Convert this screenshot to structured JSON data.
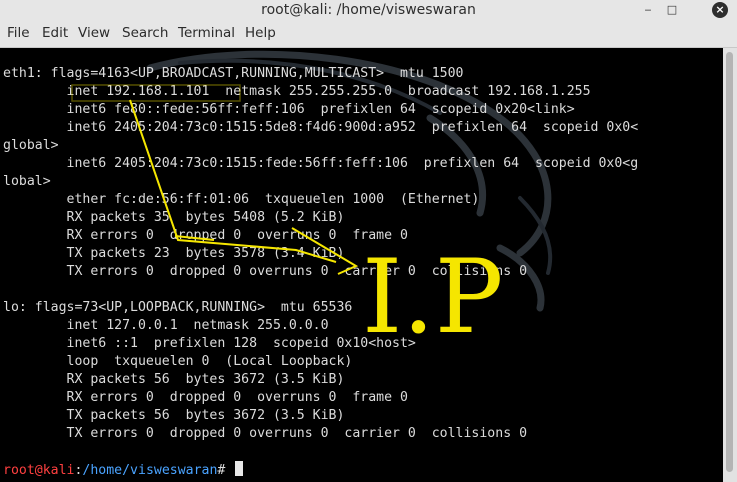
{
  "window": {
    "title": "root@kali: /home/visweswaran",
    "minimize_glyph": "‒",
    "maximize_glyph": "□",
    "close_glyph": "×"
  },
  "menu": {
    "file": "File",
    "edit": "Edit",
    "view": "View",
    "search": "Search",
    "terminal": "Terminal",
    "help": "Help"
  },
  "terminal": {
    "lines": [
      "eth1: flags=4163<UP,BROADCAST,RUNNING,MULTICAST>  mtu 1500",
      "        inet 192.168.1.101  netmask 255.255.255.0  broadcast 192.168.1.255",
      "        inet6 fe80::fede:56ff:feff:106  prefixlen 64  scopeid 0x20<link>",
      "        inet6 2405:204:73c0:1515:5de8:f4d6:900d:a952  prefixlen 64  scopeid 0x0<",
      "global>",
      "        inet6 2405:204:73c0:1515:fede:56ff:feff:106  prefixlen 64  scopeid 0x0<g",
      "lobal>",
      "        ether fc:de:56:ff:01:06  txqueuelen 1000  (Ethernet)",
      "        RX packets 35  bytes 5408 (5.2 KiB)",
      "        RX errors 0  dropped 0  overruns 0  frame 0",
      "        TX packets 23  bytes 3578 (3.4 KiB)",
      "        TX errors 0  dropped 0 overruns 0  carrier 0  collisions 0",
      "",
      "lo: flags=73<UP,LOOPBACK,RUNNING>  mtu 65536",
      "        inet 127.0.0.1  netmask 255.0.0.0",
      "        inet6 ::1  prefixlen 128  scopeid 0x10<host>",
      "        loop  txqueuelen 0  (Local Loopback)",
      "        RX packets 56  bytes 3672 (3.5 KiB)",
      "        RX errors 0  dropped 0  overruns 0  frame 0",
      "        TX packets 56  bytes 3672 (3.5 KiB)",
      "        TX errors 0  dropped 0 overruns 0  carrier 0  collisions 0"
    ],
    "prompt": {
      "user_host": "root@kali",
      "colon": ":",
      "path": "/home/visweswaran",
      "symbol": "#"
    }
  },
  "annotation": {
    "label": "I.P",
    "color": "#f5e600"
  },
  "colors": {
    "terminal_bg": "#000000",
    "terminal_fg": "#dcdcdc",
    "prompt_user": "#ff4040",
    "prompt_path": "#4aa3ff",
    "chrome": "#e6e6e6"
  }
}
